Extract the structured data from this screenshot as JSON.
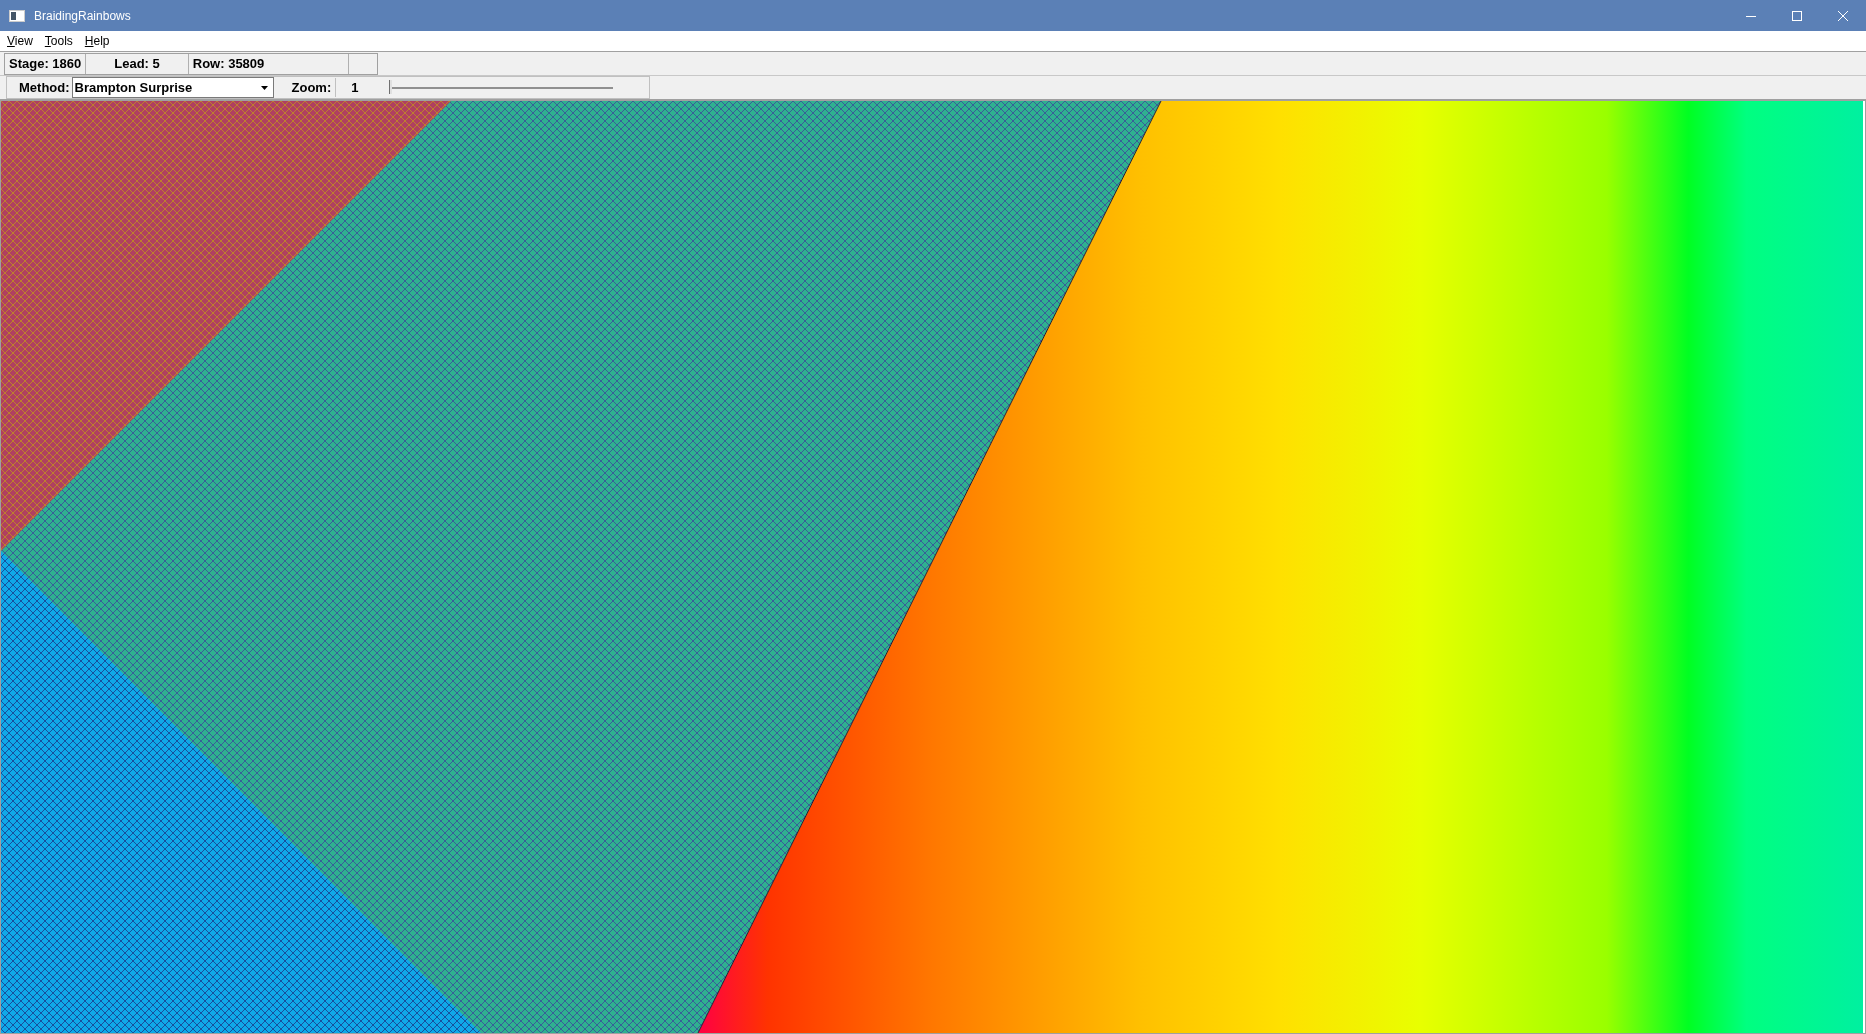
{
  "window": {
    "title": "BraidingRainbows"
  },
  "menu": [
    "View",
    "Tools",
    "Help"
  ],
  "status": {
    "stage": "Stage: 1860",
    "lead": "Lead: 5",
    "row": "Row: 35809"
  },
  "toolbar": {
    "method_label": "Method:",
    "method_value": "Brampton Surprise",
    "zoom_label": "Zoom:",
    "zoom_value": "1",
    "zoom_slider": {
      "level": 0
    }
  }
}
